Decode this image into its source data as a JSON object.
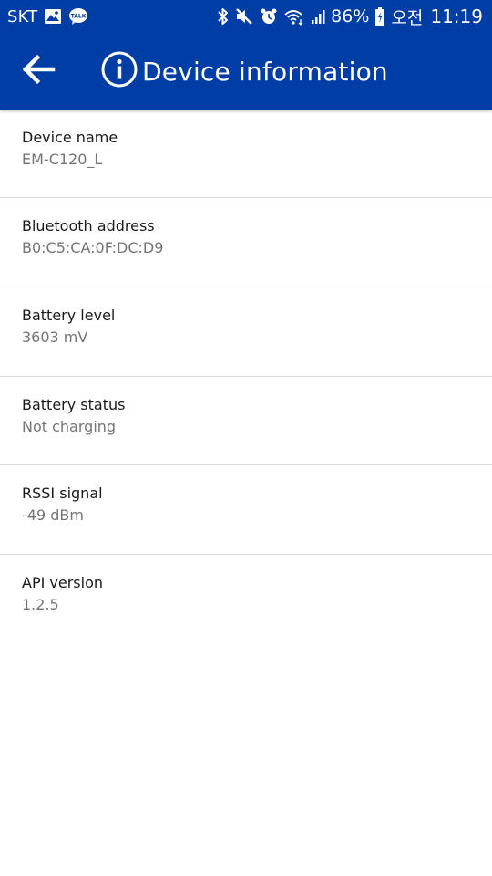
{
  "status_bar": {
    "carrier": "SKT",
    "battery_percent": "86%",
    "ampm": "오전",
    "time": "11:19",
    "icons": [
      "gallery-icon",
      "kakaotalk-icon",
      "bluetooth-icon",
      "mute-icon",
      "alarm-icon",
      "wifi-icon",
      "signal-icon",
      "battery-icon"
    ]
  },
  "app_bar": {
    "title": "Device information",
    "back_icon": "arrow-back-icon",
    "info_icon": "info-icon"
  },
  "items": [
    {
      "label": "Device name",
      "value": "EM-C120_L"
    },
    {
      "label": "Bluetooth address",
      "value": "B0:C5:CA:0F:DC:D9"
    },
    {
      "label": "Battery level",
      "value": "3603 mV"
    },
    {
      "label": "Battery status",
      "value": "Not charging"
    },
    {
      "label": "RSSI signal",
      "value": "-49 dBm"
    },
    {
      "label": "API version",
      "value": "1.2.5"
    }
  ],
  "colors": {
    "primary": "#003da5",
    "divider": "#d9d9d9",
    "label_text": "#1a1a1a",
    "value_text": "#757575"
  }
}
